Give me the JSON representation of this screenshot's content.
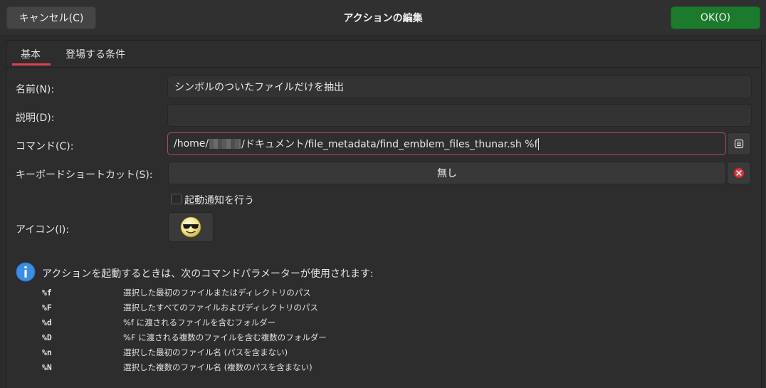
{
  "header": {
    "cancel_label": "キャンセル(C)",
    "title": "アクションの編集",
    "ok_label": "OK(O)"
  },
  "tabs": [
    {
      "label": "基本",
      "active": true
    },
    {
      "label": "登場する条件",
      "active": false
    }
  ],
  "form": {
    "name_label": "名前(N):",
    "name_value": "シンボルのついたファイルだけを抽出",
    "desc_label": "説明(D):",
    "desc_value": "",
    "command_label": "コマンド(C):",
    "command_prefix": "/home/",
    "command_suffix": "/ドキュメント/file_metadata/find_emblem_files_thunar.sh %f",
    "shortcut_label": "キーボードショートカット(S):",
    "shortcut_value": "無し",
    "startup_notify_label": "起動通知を行う",
    "startup_notify_checked": false,
    "icon_label": "アイコン(I):",
    "icon_name": "cool-sunglasses-smiley-icon"
  },
  "info": {
    "text": "アクションを起動するときは、次のコマンドパラメーターが使用されます:",
    "params": [
      {
        "key": "%f",
        "desc": "選択した最初のファイルまたはディレクトリのパス"
      },
      {
        "key": "%F",
        "desc": "選択したすべてのファイルおよびディレクトリのパス"
      },
      {
        "key": "%d",
        "desc": "%f に渡されるファイルを含むフォルダー"
      },
      {
        "key": "%D",
        "desc": "%F に渡される複数のファイルを含む複数のフォルダー"
      },
      {
        "key": "%n",
        "desc": "選択した最初のファイル名 (パスを含まない)"
      },
      {
        "key": "%N",
        "desc": "選択した複数のファイル名 (複数のパスを含まない)"
      }
    ]
  },
  "colors": {
    "ok_button": "#1b7a2b",
    "tab_underline": "#e04050",
    "focus_border": "#b04a5a",
    "clear_icon": "#d9303a",
    "info_icon": "#3a8ee6"
  }
}
